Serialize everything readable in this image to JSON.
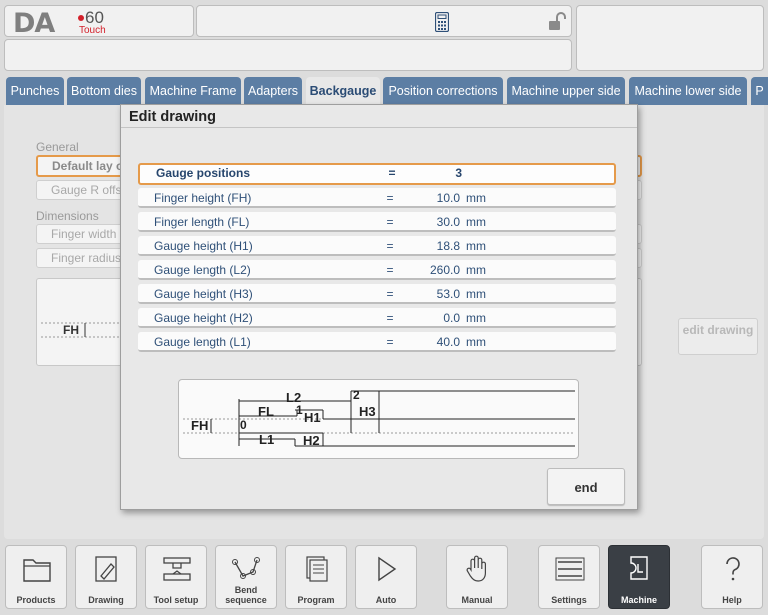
{
  "logo": {
    "brand": "DA",
    "model": "60",
    "variant": "Touch"
  },
  "header": {
    "calculator_icon": "calculator-icon",
    "lock_icon": "unlocked-padlock-icon"
  },
  "tabs": [
    {
      "label": "Punches"
    },
    {
      "label": "Bottom dies"
    },
    {
      "label": "Machine Frame"
    },
    {
      "label": "Adapters"
    },
    {
      "label": "Backgauge",
      "active": true
    },
    {
      "label": "Position corrections"
    },
    {
      "label": "Machine upper side"
    },
    {
      "label": "Machine lower side"
    },
    {
      "label": "P"
    }
  ],
  "background": {
    "section_general": "General",
    "field_default_lay": "Default lay o",
    "field_gauge_r": "Gauge R offs",
    "section_dimensions": "Dimensions",
    "field_finger_width": "Finger width",
    "field_finger_radius": "Finger radius",
    "preview_label": "FH",
    "edit_drawing": "edit drawing"
  },
  "dialog": {
    "title": "Edit drawing",
    "rows": [
      {
        "label": "Gauge positions",
        "eq": "=",
        "value": "3",
        "unit": ""
      },
      {
        "label": "Finger height (FH)",
        "eq": "=",
        "value": "10.0",
        "unit": "mm"
      },
      {
        "label": "Finger length (FL)",
        "eq": "=",
        "value": "30.0",
        "unit": "mm"
      },
      {
        "label": "Gauge height (H1)",
        "eq": "=",
        "value": "18.8",
        "unit": "mm"
      },
      {
        "label": "Gauge length (L2)",
        "eq": "=",
        "value": "260.0",
        "unit": "mm"
      },
      {
        "label": "Gauge height (H3)",
        "eq": "=",
        "value": "53.0",
        "unit": "mm"
      },
      {
        "label": "Gauge height (H2)",
        "eq": "=",
        "value": "0.0",
        "unit": "mm"
      },
      {
        "label": "Gauge length (L1)",
        "eq": "=",
        "value": "40.0",
        "unit": "mm"
      }
    ],
    "diagram_labels": {
      "l2": "L2",
      "two": "2",
      "fl": "FL",
      "one": "1",
      "h1": "H1",
      "h3": "H3",
      "fh": "FH",
      "zero": "0",
      "l1": "L1",
      "h2": "H2"
    },
    "end_label": "end"
  },
  "nav": [
    {
      "label": "Products",
      "icon": "folder-icon"
    },
    {
      "label": "Drawing",
      "icon": "pencil-drawing-icon"
    },
    {
      "label": "Tool setup",
      "icon": "tool-setup-icon"
    },
    {
      "label": "Bend sequence",
      "icon": "bend-sequence-icon"
    },
    {
      "label": "Program",
      "icon": "program-pages-icon"
    },
    {
      "label": "Auto",
      "icon": "play-icon"
    },
    {
      "label": "Manual",
      "icon": "hand-icon"
    },
    {
      "label": "Settings",
      "icon": "settings-list-icon"
    },
    {
      "label": "Machine",
      "icon": "machine-icon",
      "active": true
    },
    {
      "label": "Help",
      "icon": "help-icon"
    }
  ]
}
